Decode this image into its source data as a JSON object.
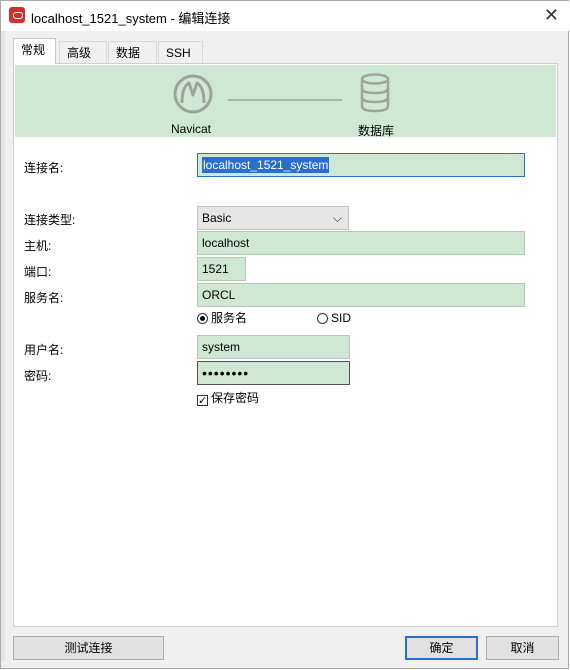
{
  "window": {
    "title": "localhost_1521_system - 编辑连接",
    "close_glyph": "✕"
  },
  "tabs": [
    {
      "label": "常规",
      "active": true
    },
    {
      "label": "高级",
      "active": false
    },
    {
      "label": "数据库",
      "active": false
    },
    {
      "label": "SSH",
      "active": false
    }
  ],
  "banner": {
    "left_label": "Navicat",
    "right_label": "数据库"
  },
  "form": {
    "connection_name_label": "连接名:",
    "connection_name_value": "localhost_1521_system",
    "connection_type_label": "连接类型:",
    "connection_type_value": "Basic",
    "host_label": "主机:",
    "host_value": "localhost",
    "port_label": "端口:",
    "port_value": "1521",
    "service_label": "服务名:",
    "service_value": "ORCL",
    "radio_service_name": "服务名",
    "radio_sid": "SID",
    "username_label": "用户名:",
    "username_value": "system",
    "password_label": "密码:",
    "password_value": "••••••••",
    "save_password_label": "保存密码",
    "save_password_checked": true
  },
  "buttons": {
    "test": "测试连接",
    "ok": "确定",
    "cancel": "取消"
  },
  "colors": {
    "field_bg": "#cfe8d4",
    "accent": "#2a6fd0",
    "app_icon": "#d32f2f"
  }
}
